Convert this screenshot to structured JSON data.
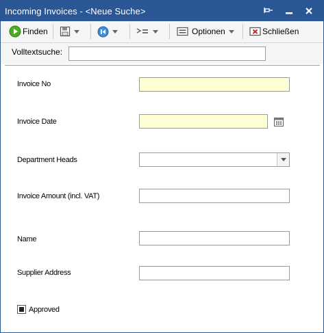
{
  "window": {
    "title": "Incoming Invoices - <Neue Suche>"
  },
  "toolbar": {
    "find_label": "Finden",
    "options_label": "Optionen",
    "close_label": "Schließen"
  },
  "search": {
    "label": "Volltextsuche:",
    "value": ""
  },
  "form": {
    "invoice_no": {
      "label": "Invoice No",
      "value": ""
    },
    "invoice_date": {
      "label": "Invoice Date",
      "value": ""
    },
    "department_heads": {
      "label": "Department Heads",
      "value": ""
    },
    "invoice_amount": {
      "label": "Invoice Amount (incl. VAT)",
      "value": ""
    },
    "name": {
      "label": "Name",
      "value": ""
    },
    "supplier_address": {
      "label": "Supplier Address",
      "value": ""
    },
    "approved": {
      "label": "Approved",
      "state": "indeterminate"
    }
  },
  "colors": {
    "titlebar": "#2b5797",
    "required_field": "#ffffd6",
    "toolbar_bg": "#f5f5f5"
  }
}
